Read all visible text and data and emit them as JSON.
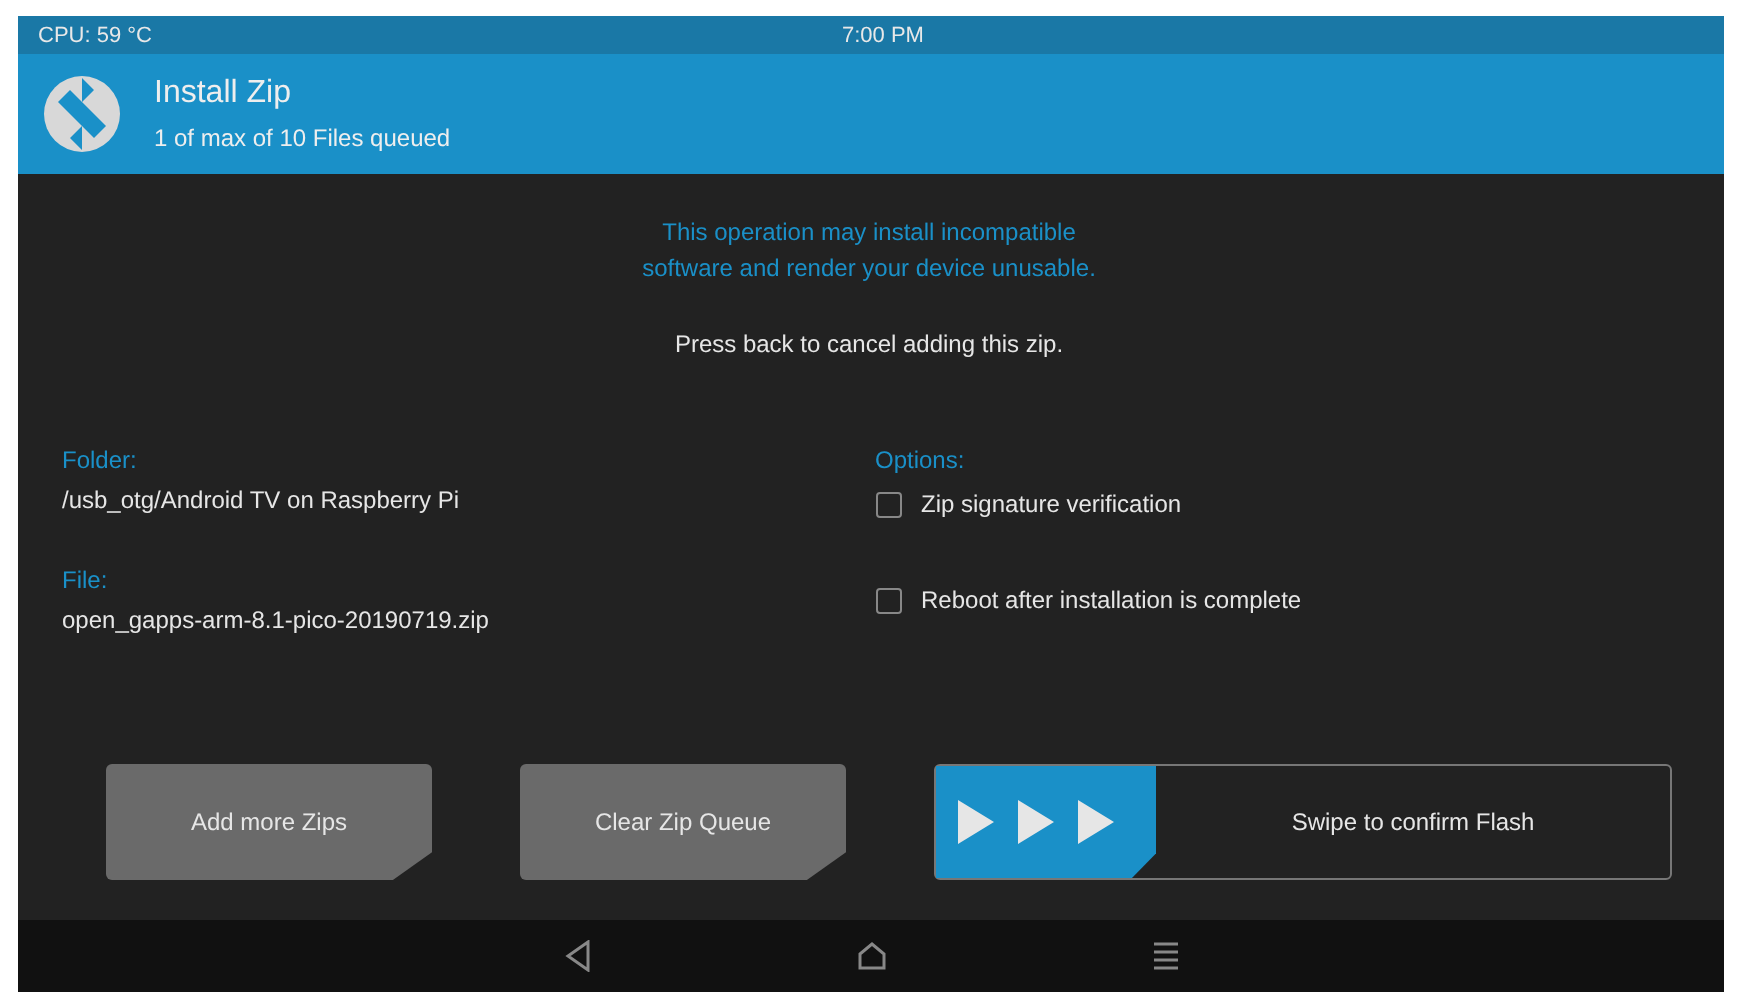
{
  "status_bar": {
    "cpu": "CPU: 59 °C",
    "time": "7:00 PM"
  },
  "header": {
    "title": "Install Zip",
    "subtitle": "1 of max of 10 Files queued"
  },
  "warning": [
    "This operation may install incompatible",
    "software and render your device unusable."
  ],
  "hint": "Press back to cancel adding this zip.",
  "folder": {
    "label": "Folder:",
    "value": "/usb_otg/Android TV on Raspberry Pi"
  },
  "file": {
    "label": "File:",
    "value": "open_gapps-arm-8.1-pico-20190719.zip"
  },
  "options": {
    "label": "Options:",
    "items": [
      {
        "label": "Zip signature verification",
        "checked": false
      },
      {
        "label": "Reboot after installation is complete",
        "checked": false
      }
    ]
  },
  "buttons": [
    "Add more Zips",
    "Clear Zip Queue"
  ],
  "swipe": {
    "label": "Swipe to confirm Flash",
    "level": 0.3
  }
}
